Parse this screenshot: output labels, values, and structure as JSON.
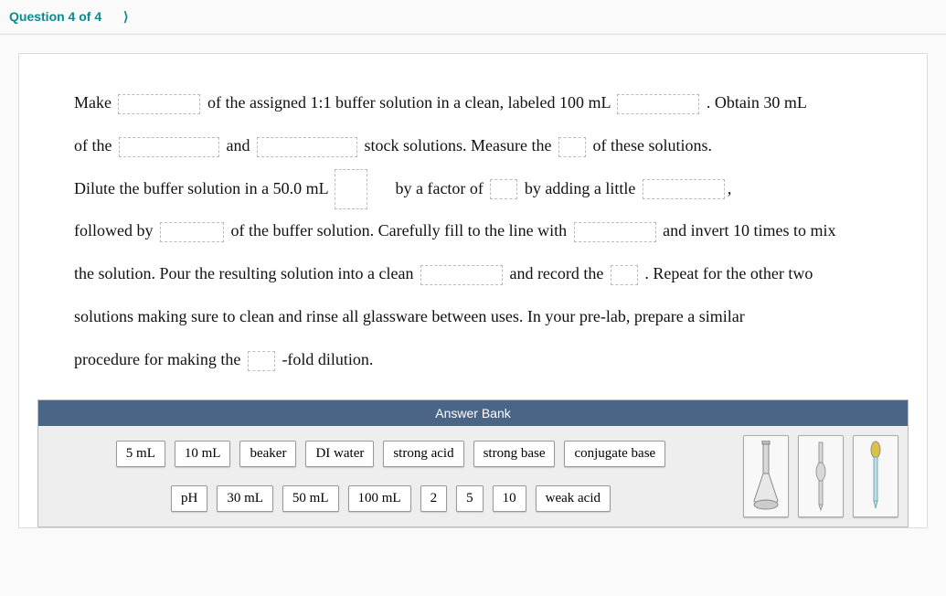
{
  "header": {
    "question_label": "Question 4 of 4"
  },
  "passage": {
    "t1": "Make",
    "t2": "of the assigned 1:1 buffer solution in a clean, labeled 100 mL",
    "t3": ". Obtain 30 mL",
    "t4": "of the",
    "t5": "and",
    "t6": "stock solutions. Measure the",
    "t7": "of these solutions.",
    "t8": "Dilute the buffer solution in a 50.0 mL",
    "t9": "by a factor of",
    "t10": "by adding a little",
    "t11": ",",
    "t12": "followed by",
    "t13": "of the buffer solution. Carefully fill to the line with",
    "t14": "and invert 10 times to mix",
    "t15": "the solution. Pour the resulting solution into a clean",
    "t16": "and record the",
    "t17": ". Repeat for the other two",
    "t18": "solutions making sure to clean and rinse all glassware between uses. In your pre-lab, prepare a similar",
    "t19": "procedure for making the",
    "t20": "-fold dilution."
  },
  "answer_bank": {
    "title": "Answer Bank",
    "row1": [
      "5 mL",
      "10 mL",
      "beaker",
      "DI water",
      "strong acid",
      "strong base",
      "conjugate base"
    ],
    "row2": [
      "pH",
      "30 mL",
      "50 mL",
      "100 mL",
      "2",
      "5",
      "10",
      "weak acid"
    ],
    "images": [
      "volumetric-flask-icon",
      "pipette-icon",
      "dropper-icon"
    ]
  }
}
